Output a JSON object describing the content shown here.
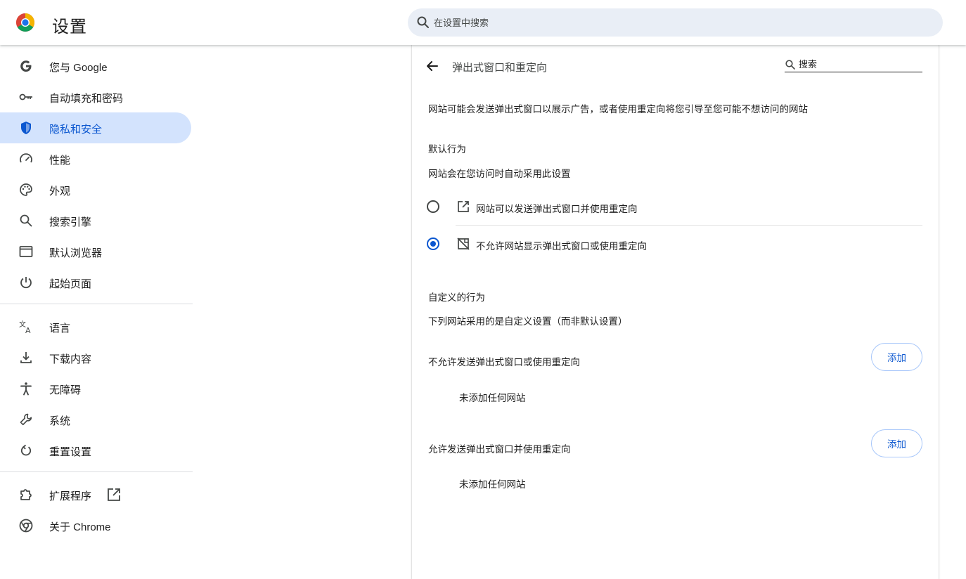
{
  "header": {
    "title": "设置",
    "search_placeholder": "在设置中搜索"
  },
  "sidebar": {
    "items": [
      {
        "label": "您与 Google",
        "icon": "google-g-icon"
      },
      {
        "label": "自动填充和密码",
        "icon": "key-icon"
      },
      {
        "label": "隐私和安全",
        "icon": "shield-icon",
        "active": true
      },
      {
        "label": "性能",
        "icon": "speedometer-icon"
      },
      {
        "label": "外观",
        "icon": "palette-icon"
      },
      {
        "label": "搜索引擎",
        "icon": "search-icon"
      },
      {
        "label": "默认浏览器",
        "icon": "browser-window-icon"
      },
      {
        "label": "起始页面",
        "icon": "power-icon"
      },
      {
        "label": "语言",
        "icon": "translate-icon"
      },
      {
        "label": "下载内容",
        "icon": "download-icon"
      },
      {
        "label": "无障碍",
        "icon": "accessibility-icon"
      },
      {
        "label": "系统",
        "icon": "wrench-icon"
      },
      {
        "label": "重置设置",
        "icon": "reset-icon"
      },
      {
        "label": "扩展程序",
        "icon": "puzzle-icon"
      },
      {
        "label": "关于 Chrome",
        "icon": "chrome-icon"
      }
    ]
  },
  "main": {
    "title": "弹出式窗口和重定向",
    "search_placeholder": "搜索",
    "description": "网站可能会发送弹出式窗口以展示广告，或者使用重定向将您引导至您可能不想访问的网站",
    "default_behavior": {
      "heading": "默认行为",
      "subheading": "网站会在您访问时自动采用此设置",
      "options": [
        {
          "label": "网站可以发送弹出式窗口并使用重定向",
          "icon": "open-in-new-icon",
          "checked": false
        },
        {
          "label": "不允许网站显示弹出式窗口或使用重定向",
          "icon": "popup-blocked-icon",
          "checked": true
        }
      ]
    },
    "custom_behavior": {
      "heading": "自定义的行为",
      "subheading": "下列网站采用的是自定义设置（而非默认设置）",
      "block_list": {
        "label": "不允许发送弹出式窗口或使用重定向",
        "add_label": "添加",
        "empty_text": "未添加任何网站"
      },
      "allow_list": {
        "label": "允许发送弹出式窗口并使用重定向",
        "add_label": "添加",
        "empty_text": "未添加任何网站"
      }
    }
  },
  "colors": {
    "accent": "#0b57d0",
    "active_nav_bg": "#d3e3fd",
    "search_bg": "#e9eef6",
    "text": "#1f1f1f"
  }
}
